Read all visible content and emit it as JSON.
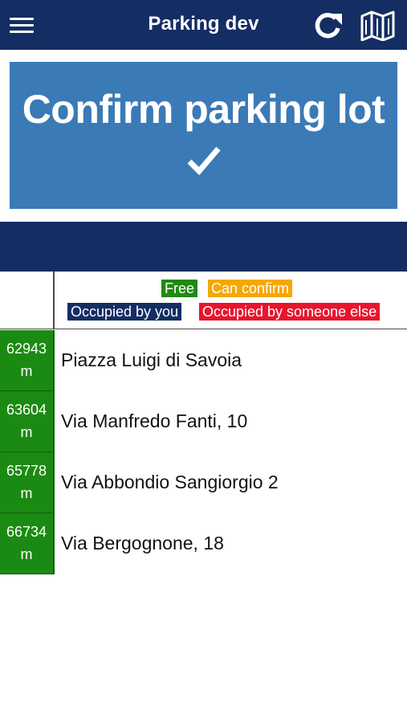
{
  "appbar": {
    "title": "Parking dev",
    "menu_icon": "hamburger-menu-icon",
    "refresh_icon": "refresh-icon",
    "map_icon": "map-icon"
  },
  "confirm": {
    "label": "Confirm parking lot",
    "icon": "checkmark-icon"
  },
  "legend": {
    "free": "Free",
    "can_confirm": "Can confirm",
    "occupied_you": "Occupied by you",
    "occupied_else": "Occupied by someone else"
  },
  "lots": [
    {
      "distance": "62943",
      "unit": "m",
      "name": "Piazza Luigi di Savoia",
      "status": "free"
    },
    {
      "distance": "63604",
      "unit": "m",
      "name": "Via Manfredo Fanti, 10",
      "status": "free"
    },
    {
      "distance": "65778",
      "unit": "m",
      "name": "Via Abbondio Sangiorgio 2",
      "status": "free"
    },
    {
      "distance": "66734",
      "unit": "m",
      "name": "Via Bergognone, 18",
      "status": "free"
    }
  ],
  "colors": {
    "navy": "#142d63",
    "button_blue": "#3a7ab6",
    "free_green": "#1b8a12",
    "can_confirm_orange": "#f5a800",
    "occupied_else_red": "#e8152c"
  }
}
